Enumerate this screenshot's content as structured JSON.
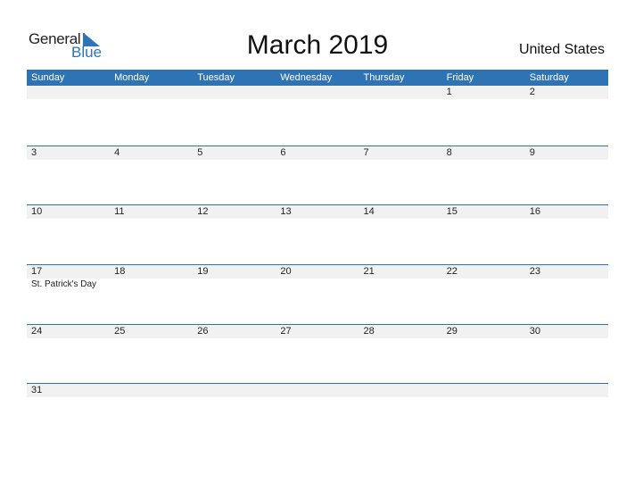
{
  "logo": {
    "line1": "General",
    "line2": "Blue"
  },
  "title": "March 2019",
  "country": "United States",
  "colors": {
    "header": "#2e73b3",
    "band": "#f1f1f1",
    "brand_blue": "#2a75bb"
  },
  "weekdays": [
    "Sunday",
    "Monday",
    "Tuesday",
    "Wednesday",
    "Thursday",
    "Friday",
    "Saturday"
  ],
  "weeks": [
    [
      "",
      "",
      "",
      "",
      "",
      "1",
      "2"
    ],
    [
      "3",
      "4",
      "5",
      "6",
      "7",
      "8",
      "9"
    ],
    [
      "10",
      "11",
      "12",
      "13",
      "14",
      "15",
      "16"
    ],
    [
      "17",
      "18",
      "19",
      "20",
      "21",
      "22",
      "23"
    ],
    [
      "24",
      "25",
      "26",
      "27",
      "28",
      "29",
      "30"
    ],
    [
      "31",
      "",
      "",
      "",
      "",
      "",
      ""
    ]
  ],
  "holidays": [
    {
      "week": 3,
      "day": 0,
      "label": "St. Patrick's Day"
    }
  ]
}
